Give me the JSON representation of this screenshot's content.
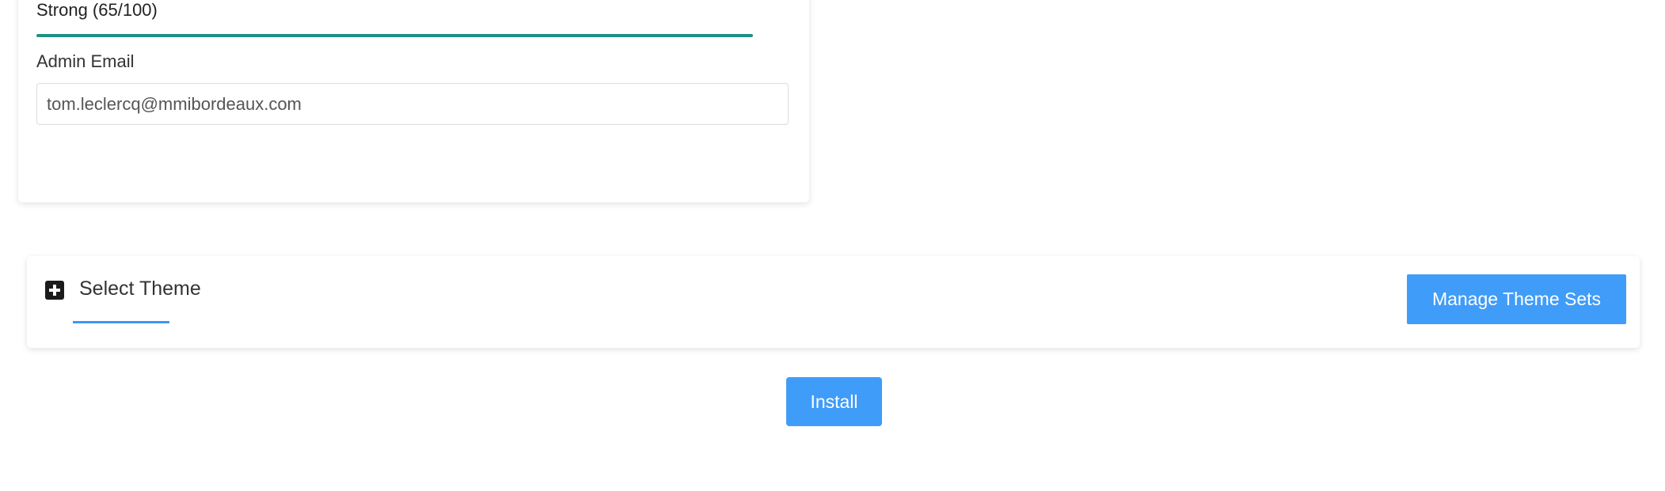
{
  "admin": {
    "password_strength_label": "Strong (65/100)",
    "password_strength_value": 0.65,
    "email_label": "Admin Email",
    "email_value": "tom.leclercq@mmibordeaux.com"
  },
  "theme": {
    "title": "Select Theme",
    "manage_button_label": "Manage Theme Sets",
    "expand_icon": "plus-square-icon"
  },
  "actions": {
    "install_label": "Install"
  },
  "colors": {
    "accent": "#409cf9",
    "strength_bar": "#1f9184"
  }
}
